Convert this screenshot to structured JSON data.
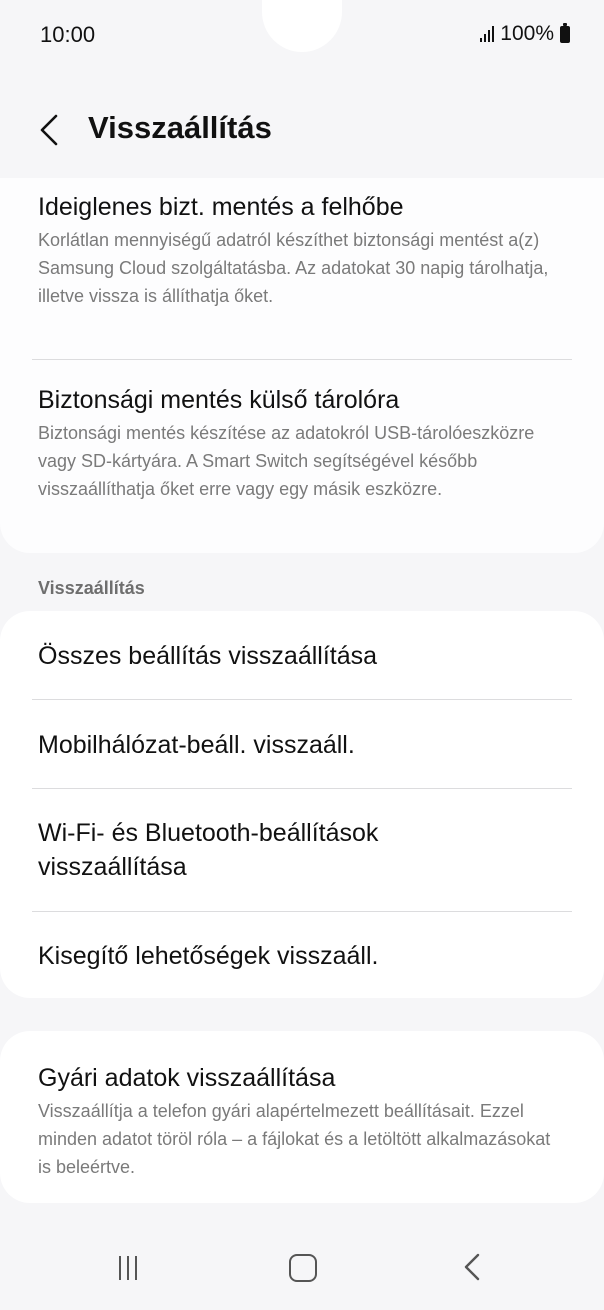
{
  "status_bar": {
    "time": "10:00",
    "battery": "100%"
  },
  "header": {
    "title": "Visszaállítás"
  },
  "backup_items": [
    {
      "title": "Ideiglenes bizt. mentés a felhőbe",
      "description": "Korlátlan mennyiségű adatról készíthet biztonsági mentést a(z) Samsung Cloud szolgáltatásba. Az adatokat 30 napig tárolhatja, illetve vissza is állíthatja őket."
    },
    {
      "title": "Biztonsági mentés külső tárolóra",
      "description": "Biztonsági mentés készítése az adatokról USB-tárolóeszközre vagy SD-kártyára. A Smart Switch segítségével később visszaállíthatja őket erre vagy egy másik eszközre."
    }
  ],
  "reset_section": {
    "label": "Visszaállítás",
    "items": [
      {
        "title": "Összes beállítás visszaállítása"
      },
      {
        "title": "Mobilhálózat-beáll. visszaáll."
      },
      {
        "title": "Wi-Fi- és Bluetooth-beállítások visszaállítása"
      },
      {
        "title": "Kisegítő lehetőségek visszaáll."
      }
    ]
  },
  "factory_reset": {
    "title": "Gyári adatok visszaállítása",
    "description": "Visszaállítja a telefon gyári alapértelmezett beállításait. Ezzel minden adatot töröl róla – a fájlokat és a letöltött alkalmazásokat is beleértve."
  },
  "icons": {
    "back": "chevron-left-icon",
    "signal": "signal-icon",
    "battery": "battery-icon",
    "recents": "recents-icon",
    "home": "home-icon",
    "nav_back": "back-nav-icon"
  }
}
